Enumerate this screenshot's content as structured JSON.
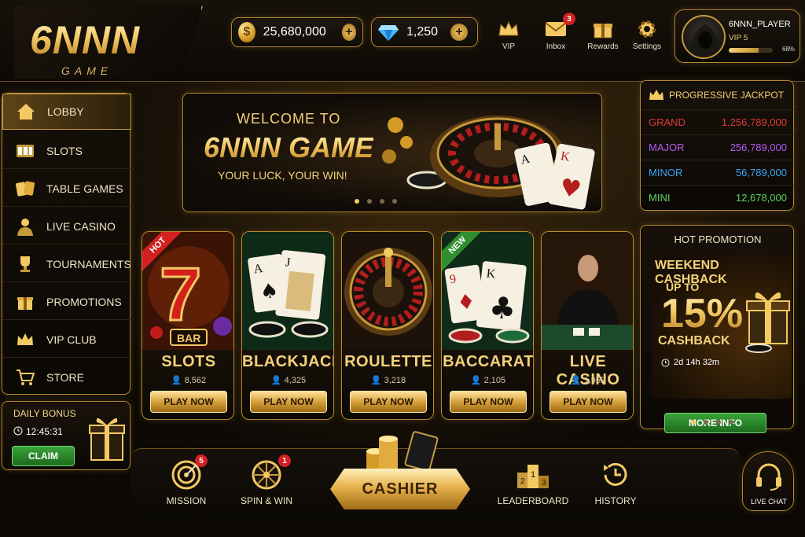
{
  "brand": {
    "logo_main": "6NNN",
    "logo_sub": "GAME"
  },
  "currency": {
    "coins": "25,680,000",
    "gems": "1,250",
    "add_symbol": "+"
  },
  "header_icons": [
    {
      "label": "VIP",
      "icon": "crown-icon"
    },
    {
      "label": "Inbox",
      "icon": "mail-icon",
      "badge": "3"
    },
    {
      "label": "Rewards",
      "icon": "gift-icon"
    },
    {
      "label": "Settings",
      "icon": "gear-icon"
    }
  ],
  "profile": {
    "name": "6NNN_PLAYER",
    "vip": "VIP 5",
    "progress_text": "68%",
    "progress": 0.68
  },
  "sidebar": {
    "items": [
      {
        "label": "LOBBY",
        "icon": "home-icon"
      },
      {
        "label": "SLOTS",
        "icon": "slot-machine-icon"
      },
      {
        "label": "TABLE GAMES",
        "icon": "cards-icon"
      },
      {
        "label": "LIVE CASINO",
        "icon": "dealer-icon"
      },
      {
        "label": "TOURNAMENTS",
        "icon": "trophy-icon"
      },
      {
        "label": "PROMOTIONS",
        "icon": "gift-icon"
      },
      {
        "label": "VIP CLUB",
        "icon": "crown-icon"
      },
      {
        "label": "STORE",
        "icon": "cart-icon"
      }
    ]
  },
  "daily_bonus": {
    "title": "DAILY BONUS",
    "timer": "12:45:31",
    "claim_label": "CLAIM"
  },
  "banner": {
    "welcome": "WELCOME TO",
    "title": "6NNN GAME",
    "subtitle": "YOUR LUCK, YOUR WIN!"
  },
  "jackpot": {
    "title": "PROGRESSIVE JACKPOT",
    "rows": [
      {
        "tier": "GRAND",
        "amount": "1,256,789,000",
        "color": "#e23a3a"
      },
      {
        "tier": "MAJOR",
        "amount": "256,789,000",
        "color": "#b85cf0"
      },
      {
        "tier": "MINOR",
        "amount": "56,789,000",
        "color": "#3aa7ef"
      },
      {
        "tier": "MINI",
        "amount": "12,678,000",
        "color": "#5cd65c"
      }
    ]
  },
  "games": [
    {
      "name": "SLOTS",
      "players": "8,562",
      "tag": "HOT",
      "play_label": "PLAY NOW"
    },
    {
      "name": "BLACKJACK",
      "players": "4,325",
      "tag": "",
      "play_label": "PLAY NOW"
    },
    {
      "name": "ROULETTE",
      "players": "3,218",
      "tag": "",
      "play_label": "PLAY NOW"
    },
    {
      "name": "BACCARAT",
      "players": "2,105",
      "tag": "NEW",
      "play_label": "PLAY NOW"
    },
    {
      "name": "LIVE CASINO",
      "players": "1,952",
      "tag": "",
      "play_label": "PLAY NOW"
    }
  ],
  "slot_bar_text": "BAR",
  "promotion": {
    "title": "HOT PROMOTION",
    "headline": "WEEKEND CASHBACK",
    "up_to": "UP TO",
    "percent": "15%",
    "cashback": "CASHBACK",
    "timer": "2d 14h 32m",
    "more_label": "MORE INFO"
  },
  "bottom_nav": [
    {
      "label": "MISSION",
      "icon": "target-icon",
      "badge": "5"
    },
    {
      "label": "SPIN & WIN",
      "icon": "wheel-icon",
      "badge": "1"
    },
    {
      "label": "LEADERBOARD",
      "icon": "podium-icon"
    },
    {
      "label": "HISTORY",
      "icon": "history-icon"
    }
  ],
  "cashier_label": "CASHIER",
  "live_chat_label": "LIVE CHAT",
  "colors": {
    "gold": "#f3c964",
    "green": "#2f8f2f",
    "badge_red": "#d32020"
  }
}
